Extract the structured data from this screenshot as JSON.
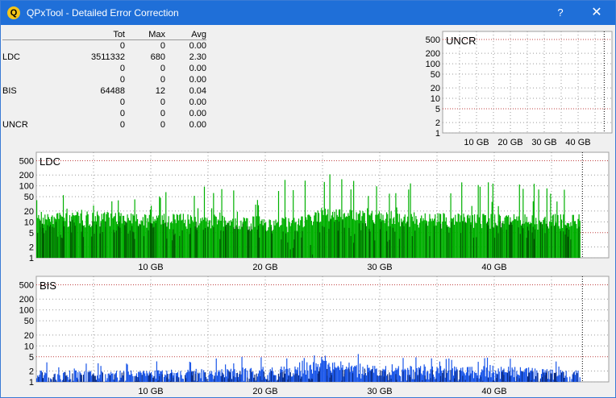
{
  "window": {
    "title": "QPxTool - Detailed Error Correction",
    "help": "?",
    "close": "✕",
    "icon": "Q"
  },
  "stats": {
    "headers": [
      "",
      "Tot",
      "Max",
      "Avg"
    ],
    "rows": [
      [
        "",
        "0",
        "0",
        "0.00"
      ],
      [
        "LDC",
        "3511332",
        "680",
        "2.30"
      ],
      [
        "",
        "0",
        "0",
        "0.00"
      ],
      [
        "",
        "0",
        "0",
        "0.00"
      ],
      [
        "BIS",
        "64488",
        "12",
        "0.04"
      ],
      [
        "",
        "0",
        "0",
        "0.00"
      ],
      [
        "",
        "0",
        "0",
        "0.00"
      ],
      [
        "UNCR",
        "0",
        "0",
        "0.00"
      ]
    ]
  },
  "chart_data": [
    {
      "type": "bar",
      "title": "UNCR",
      "yscale": "log",
      "yticks": [
        "500",
        "200",
        "100",
        "50",
        "20",
        "10",
        "5",
        "2",
        "1"
      ],
      "xticks": [
        "10 GB",
        "20 GB",
        "30 GB",
        "40 GB"
      ],
      "xlim": [
        0,
        50
      ],
      "series": [
        {
          "values": []
        }
      ],
      "color": "#00a000",
      "grid": true
    },
    {
      "type": "bar",
      "title": "LDC",
      "yscale": "log",
      "yticks": [
        "500",
        "200",
        "100",
        "50",
        "20",
        "10",
        "5",
        "2",
        "1"
      ],
      "xticks": [
        "10 GB",
        "20 GB",
        "30 GB",
        "40 GB"
      ],
      "xlim": [
        0,
        50
      ],
      "profile": [
        [
          0,
          3,
          14,
          60
        ],
        [
          5,
          3,
          14,
          80
        ],
        [
          10,
          3,
          12,
          100
        ],
        [
          15,
          3,
          12,
          120
        ],
        [
          20,
          3,
          10,
          90
        ],
        [
          23,
          1,
          10,
          200
        ],
        [
          25,
          1,
          18,
          300
        ],
        [
          28,
          2,
          15,
          150
        ],
        [
          32,
          3,
          14,
          200
        ],
        [
          38,
          3,
          12,
          150
        ],
        [
          44,
          3,
          12,
          120
        ],
        [
          47.5,
          3,
          12,
          100
        ]
      ],
      "color": "#00b000",
      "dark_color": "#005a00",
      "grid": true
    },
    {
      "type": "bar",
      "title": "BIS",
      "yscale": "log",
      "yticks": [
        "500",
        "200",
        "100",
        "50",
        "20",
        "10",
        "5",
        "2",
        "1"
      ],
      "xticks": [
        "10 GB",
        "20 GB",
        "30 GB",
        "40 GB"
      ],
      "xlim": [
        0,
        50
      ],
      "profile": [
        [
          0,
          1,
          1.5,
          4
        ],
        [
          10,
          1,
          1.5,
          4
        ],
        [
          23,
          1,
          2,
          6
        ],
        [
          25,
          1,
          3,
          8
        ],
        [
          30,
          1,
          2,
          5
        ],
        [
          40,
          1,
          2,
          5
        ],
        [
          47.5,
          1,
          1.5,
          4
        ]
      ],
      "color": "#1a56e8",
      "dark_color": "#0a2a80",
      "grid": true
    }
  ]
}
